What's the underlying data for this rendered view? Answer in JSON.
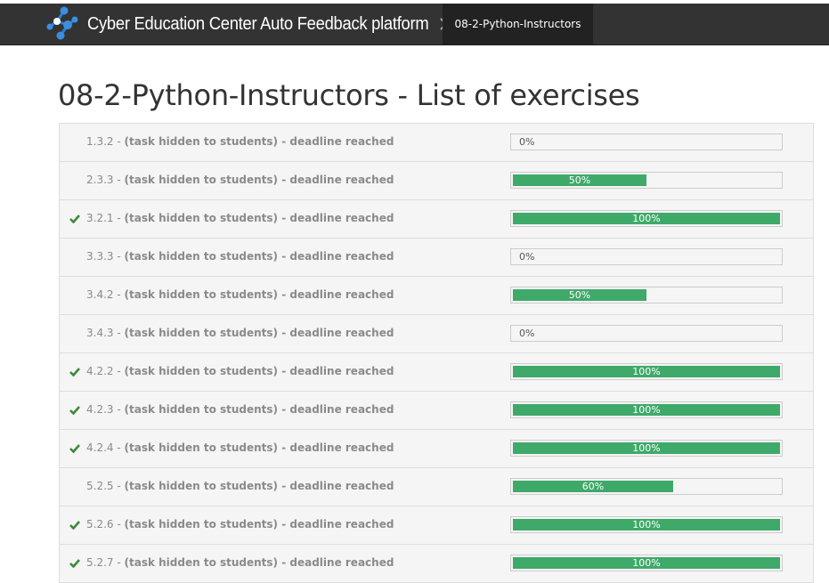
{
  "navbar": {
    "brand_title": "Cyber Education Center Auto Feedback platform",
    "breadcrumb_current": "08-2-Python-Instructors",
    "logo_icon": "network-nodes-logo",
    "separator_icon": "chevron-right-icon"
  },
  "page": {
    "title": "08-2-Python-Instructors - List of exercises"
  },
  "colors": {
    "navbar_bg": "#333333",
    "breadcrumb_bg": "#222222",
    "progress_fill": "#3fa96a",
    "check": "#3c8a3c",
    "row_bg": "#f5f5f5"
  },
  "exercises": [
    {
      "id": "1.3.2",
      "name": "(task hidden to students) - deadline reached",
      "progress": 0,
      "progress_label": "0%",
      "completed": false
    },
    {
      "id": "2.3.3",
      "name": "(task hidden to students) - deadline reached",
      "progress": 50,
      "progress_label": "50%",
      "completed": false
    },
    {
      "id": "3.2.1",
      "name": "(task hidden to students) - deadline reached",
      "progress": 100,
      "progress_label": "100%",
      "completed": true
    },
    {
      "id": "3.3.3",
      "name": "(task hidden to students) - deadline reached",
      "progress": 0,
      "progress_label": "0%",
      "completed": false
    },
    {
      "id": "3.4.2",
      "name": "(task hidden to students) - deadline reached",
      "progress": 50,
      "progress_label": "50%",
      "completed": false
    },
    {
      "id": "3.4.3",
      "name": "(task hidden to students) - deadline reached",
      "progress": 0,
      "progress_label": "0%",
      "completed": false
    },
    {
      "id": "4.2.2",
      "name": "(task hidden to students) - deadline reached",
      "progress": 100,
      "progress_label": "100%",
      "completed": true
    },
    {
      "id": "4.2.3",
      "name": "(task hidden to students) - deadline reached",
      "progress": 100,
      "progress_label": "100%",
      "completed": true
    },
    {
      "id": "4.2.4",
      "name": "(task hidden to students) - deadline reached",
      "progress": 100,
      "progress_label": "100%",
      "completed": true
    },
    {
      "id": "5.2.5",
      "name": "(task hidden to students) - deadline reached",
      "progress": 60,
      "progress_label": "60%",
      "completed": false
    },
    {
      "id": "5.2.6",
      "name": "(task hidden to students) - deadline reached",
      "progress": 100,
      "progress_label": "100%",
      "completed": true
    },
    {
      "id": "5.2.7",
      "name": "(task hidden to students) - deadline reached",
      "progress": 100,
      "progress_label": "100%",
      "completed": true
    }
  ]
}
